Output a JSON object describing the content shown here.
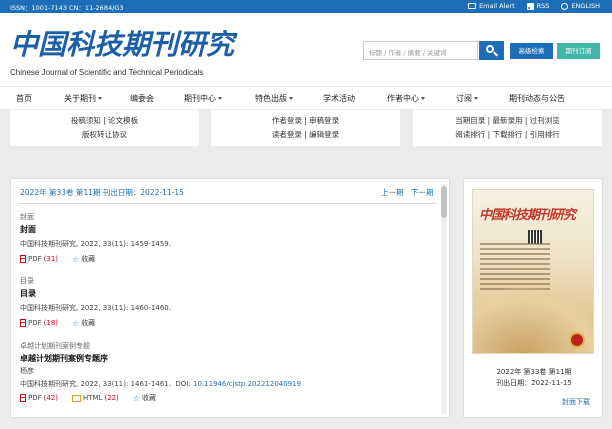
{
  "topbar": {
    "issn": "ISSN：1001-7143   CN：11-2684/G3",
    "email_alert": "Email Alert",
    "rss": "RSS",
    "english": "ENGLISH"
  },
  "header": {
    "logo_cn": "中国科技期刊研究",
    "logo_en": "Chinese Journal of Scientific and Technical Periodicals",
    "search_placeholder": "标题 / 作者 / 摘要 / 关键词",
    "advanced_search": "高级检索",
    "subscribe": "期刊订阅"
  },
  "nav": {
    "items": [
      {
        "label": "首页",
        "dropdown": false
      },
      {
        "label": "关于期刊",
        "dropdown": true
      },
      {
        "label": "编委会",
        "dropdown": false
      },
      {
        "label": "期刊中心",
        "dropdown": true
      },
      {
        "label": "特色出版",
        "dropdown": true
      },
      {
        "label": "学术活动",
        "dropdown": false
      },
      {
        "label": "作者中心",
        "dropdown": true
      },
      {
        "label": "订阅",
        "dropdown": true
      },
      {
        "label": "期刊动态与公告",
        "dropdown": false
      }
    ]
  },
  "quick": {
    "col1": {
      "line1": "投稿须知  |  论文模板",
      "line2": "版权转让协议"
    },
    "col2": {
      "line1": "作者登录  |  审稿登录",
      "line2": "读者登录  |  编辑登录"
    },
    "col3": {
      "line1": "当期目录  |  最新录用  |  过刊浏览",
      "line2": "阅读排行  |  下载排行  |  引用排行"
    }
  },
  "issue": {
    "header": "2022年 第33卷 第11期   刊出日期：2022-11-15",
    "prev": "上一期",
    "next": "下一期"
  },
  "articles": [
    {
      "category": "封面",
      "title": "封面",
      "citation": "中国科技期刊研究, 2022, 33(11): 1459-1459.",
      "doi_label": "",
      "doi": "",
      "pdf_label": "PDF",
      "pdf_count": "(31)",
      "html_label": "",
      "html_count": "",
      "favorite": "收藏"
    },
    {
      "category": "目录",
      "title": "目录",
      "citation": "中国科技期刊研究, 2022, 33(11): 1460-1460.",
      "doi_label": "",
      "doi": "",
      "pdf_label": "PDF",
      "pdf_count": "(18)",
      "html_label": "",
      "html_count": "",
      "favorite": "收藏"
    },
    {
      "category": "卓越计划期刊案例专题",
      "title": "卓越计划期刊案例专题序",
      "author": "杨彦",
      "citation": "中国科技期刊研究, 2022, 33(11): 1461-1461.",
      "doi_label": "DOI: ",
      "doi": "10.11946/cjstp.202212040919",
      "pdf_label": "PDF",
      "pdf_count": "(42)",
      "html_label": "HTML",
      "html_count": "(22)",
      "favorite": "收藏"
    }
  ],
  "cover": {
    "caption1": "2022年 第33卷 第11期",
    "caption2": "刊出日期：2022-11-15",
    "download": "封面下载"
  },
  "colors": {
    "brand_blue": "#1c6fb6",
    "teal": "#41b6a8",
    "count_red": "#d0021b"
  }
}
